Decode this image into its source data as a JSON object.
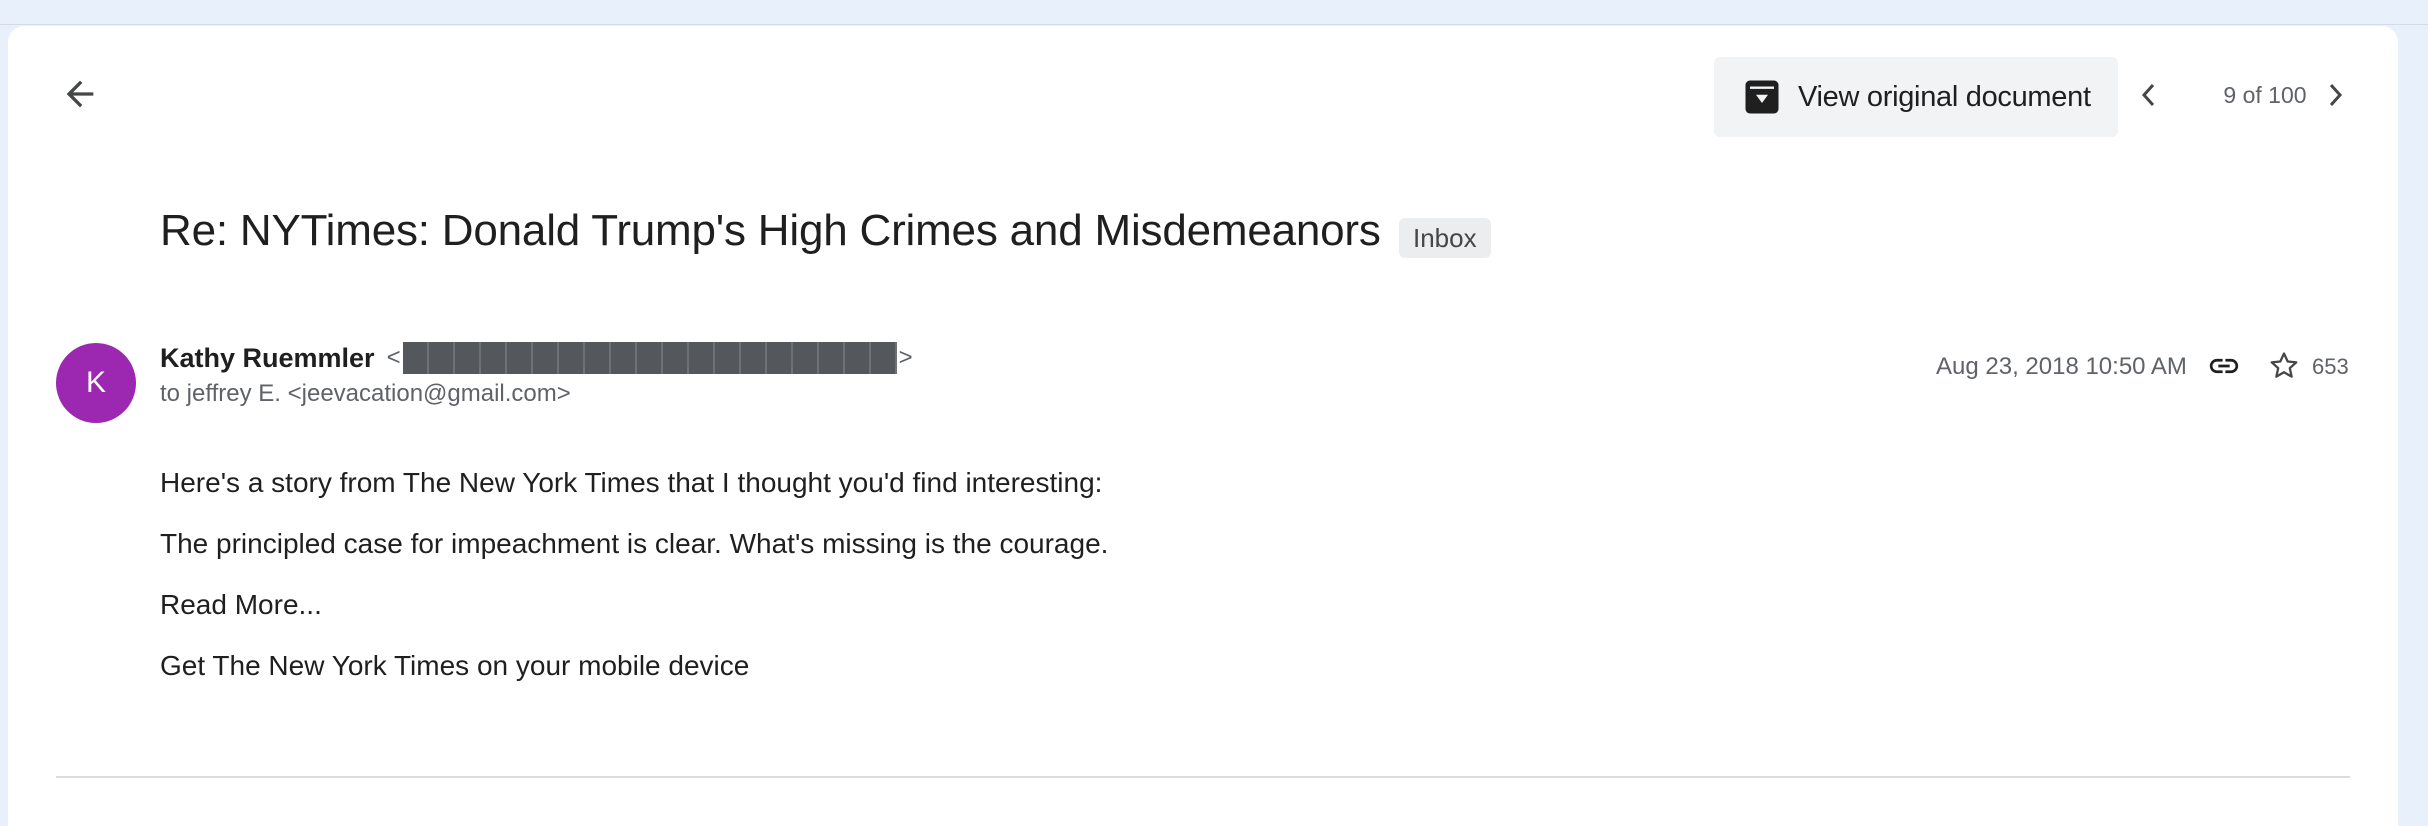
{
  "toolbar": {
    "back_icon": "arrow-left-icon",
    "view_original_label": "View original document",
    "view_original_icon": "archive-download-icon",
    "pager_text": "9 of 100",
    "prev_icon": "chevron-left-icon",
    "next_icon": "chevron-right-icon"
  },
  "email": {
    "subject": "Re: NYTimes: Donald Trump's High Crimes and Misdemeanors",
    "label_badge": "Inbox",
    "avatar_initial": "K",
    "avatar_color": "#9c27b0",
    "sender_name": "Kathy Ruemmler",
    "sender_email_open": "<",
    "sender_email_close": ">",
    "recipient": "to jeffrey E. <jeevacation@gmail.com>",
    "date": "Aug 23, 2018 10:50 AM",
    "star_count": "653",
    "body": [
      "Here's a story from The New York Times that I thought you'd find interesting:",
      "The principled case for impeachment is clear. What's missing is the courage.",
      "Read More...",
      "Get The New York Times on your mobile device"
    ]
  },
  "colors": {
    "page_background": "#e8f0fb",
    "card_background": "#ffffff",
    "button_background": "#f1f3f4",
    "badge_background": "#ebedef",
    "muted_text": "#5f6368",
    "redaction": "#54585d"
  }
}
